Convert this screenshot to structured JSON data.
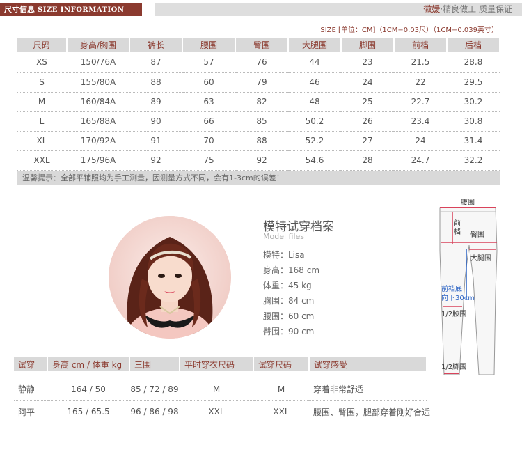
{
  "header": {
    "title_cn": "尺寸信息",
    "title_en": "SIZE INFORMATION",
    "brand": "徽媛",
    "slogan": "·精良做工 质量保证"
  },
  "size_note": "SIZE [单位：CM]（1CM=0.03尺）（1CM=0.039英寸）",
  "size_table": {
    "headers": [
      "尺码",
      "身高/胸围",
      "裤长",
      "腰围",
      "臀围",
      "大腿围",
      "脚围",
      "前档",
      "后档"
    ],
    "rows": [
      [
        "XS",
        "150/76A",
        "87",
        "57",
        "76",
        "44",
        "23",
        "21.5",
        "28.8"
      ],
      [
        "S",
        "155/80A",
        "88",
        "60",
        "79",
        "46",
        "24",
        "22",
        "29.5"
      ],
      [
        "M",
        "160/84A",
        "89",
        "63",
        "82",
        "48",
        "25",
        "22.7",
        "30.2"
      ],
      [
        "L",
        "165/88A",
        "90",
        "66",
        "85",
        "50.2",
        "26",
        "23.4",
        "30.8"
      ],
      [
        "XL",
        "170/92A",
        "91",
        "70",
        "88",
        "52.2",
        "27",
        "24",
        "31.4"
      ],
      [
        "XXL",
        "175/96A",
        "92",
        "75",
        "92",
        "54.6",
        "28",
        "24.7",
        "32.2"
      ]
    ]
  },
  "tip": "温馨提示：全部平铺照均为手工测量，因测量方式不同，会有1-3cm的误差！",
  "model": {
    "title": "模特试穿档案",
    "subtitle": "Model files",
    "lines": [
      "模特：Lisa",
      "身高：168 cm",
      "体重：45 kg",
      "胸围：84 cm",
      "腰围：60 cm",
      "臀围：90 cm"
    ]
  },
  "diagram": {
    "waist": "腰围",
    "front_rise": "前档",
    "hip": "臀围",
    "thigh": "大腿围",
    "rise_note_1": "前裆底",
    "rise_note_2": "向下30cm",
    "knee": "1/2膝围",
    "hem": "1/2脚围"
  },
  "try_table": {
    "headers": [
      "试穿",
      "身高 cm / 体重 kg",
      "三围",
      "平时穿衣尺码",
      "试穿尺码",
      "试穿感受"
    ],
    "rows": [
      [
        "静静",
        "164 / 50",
        "85 / 72 / 89",
        "M",
        "M",
        "穿着非常舒适"
      ],
      [
        "阿平",
        "165 / 65.5",
        "96 / 86 / 98",
        "XXL",
        "XXL",
        "腰围、臀围，腿部穿着刚好合适"
      ]
    ]
  },
  "colors": {
    "accent": "#8b3a2f",
    "header_gray": "#dedede",
    "table_gray": "#d9d9d9",
    "measure_red": "#d9435b",
    "measure_blue": "#2b63c4"
  }
}
